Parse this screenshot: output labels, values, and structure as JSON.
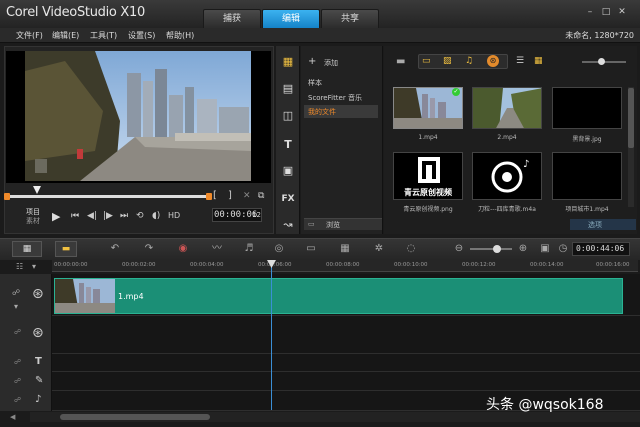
{
  "app": {
    "title": "Corel VideoStudio X10"
  },
  "main_tabs": [
    {
      "label": "捕获"
    },
    {
      "label": "编辑"
    },
    {
      "label": "共享"
    }
  ],
  "menu": [
    {
      "label": "文件(F)"
    },
    {
      "label": "编辑(E)"
    },
    {
      "label": "工具(T)"
    },
    {
      "label": "设置(S)"
    },
    {
      "label": "帮助(H)"
    }
  ],
  "project_info": "未命名, 1280*720",
  "player": {
    "mode_project": "项目",
    "mode_clip": "素材",
    "hd_label": "HD",
    "timecode": "00:00:06",
    "timecode_frames": "12"
  },
  "library": {
    "add_label": "添加",
    "folders": [
      {
        "label": "样本"
      },
      {
        "label": "ScoreFitter 音乐"
      },
      {
        "label": "我的文件"
      }
    ],
    "browse_label": "浏览",
    "options_label": "选项",
    "thumbs": [
      {
        "label": "1.mp4"
      },
      {
        "label": "2.mp4"
      },
      {
        "label": "黑背景.jpg"
      },
      {
        "label": "青云原创视频.png"
      },
      {
        "label": "刀粒---四库青歌.m4a"
      },
      {
        "label": "项目城市1.mp4"
      }
    ],
    "thumb4_text": "青云原创视频"
  },
  "timeline": {
    "duration": "0:00:44:06",
    "ruler_ticks": [
      "00:00:00:00",
      "00:00:02:00",
      "00:00:04:00",
      "00:00:06:00",
      "00:00:08:00",
      "00:00:10:00",
      "00:00:12:00",
      "00:00:14:00",
      "00:00:16:00"
    ],
    "clip_label": "1.mp4"
  },
  "watermark": "头条 @wqsok168",
  "colors": {
    "accent": "#1b8fd6",
    "clip": "#1b8f76",
    "playhead": "#3b8fd6",
    "scrub_orange": "#f08a2a"
  }
}
